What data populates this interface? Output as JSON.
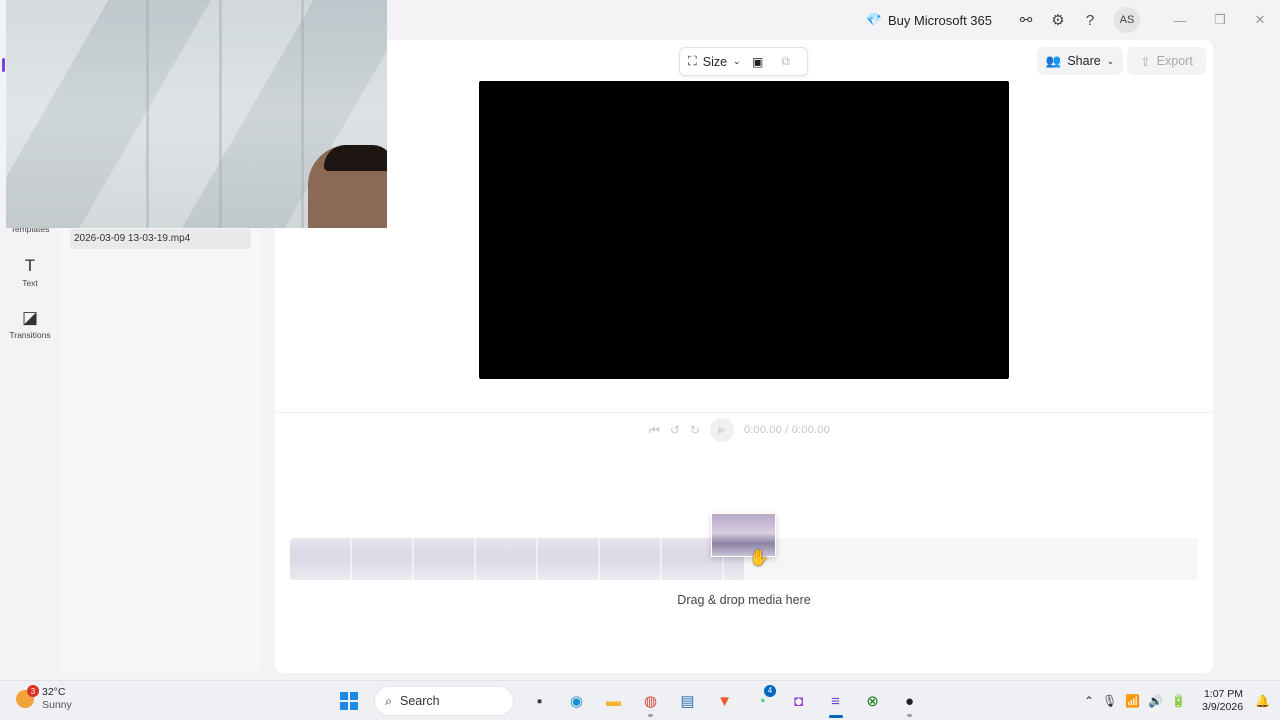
{
  "titlebar": {
    "buy_label": "Buy Microsoft 365",
    "avatar_initials": "AS",
    "icons": [
      "diamond-icon",
      "share-link-icon",
      "gear-icon",
      "help-icon"
    ]
  },
  "rail": {
    "items": [
      {
        "label": "Templates",
        "icon": "templates-icon"
      },
      {
        "label": "Text",
        "icon": "text-icon"
      },
      {
        "label": "Transitions",
        "icon": "transitions-icon"
      }
    ],
    "accent_color": "#7b3fe4"
  },
  "media": {
    "file_name": "2026-03-09 13-03-19.mp4"
  },
  "toolbar": {
    "size_label": "Size",
    "share_label": "Share",
    "export_label": "Export"
  },
  "player": {
    "timecode": "0:00.00 / 0:00.00"
  },
  "timeline": {
    "drop_hint": "Drag & drop media here"
  },
  "taskbar": {
    "weather_temp": "32°C",
    "weather_desc": "Sunny",
    "weather_badge": "3",
    "search_label": "Search",
    "whatsapp_badge": "4",
    "time": "1:07 PM",
    "date": "3/9/2026"
  }
}
